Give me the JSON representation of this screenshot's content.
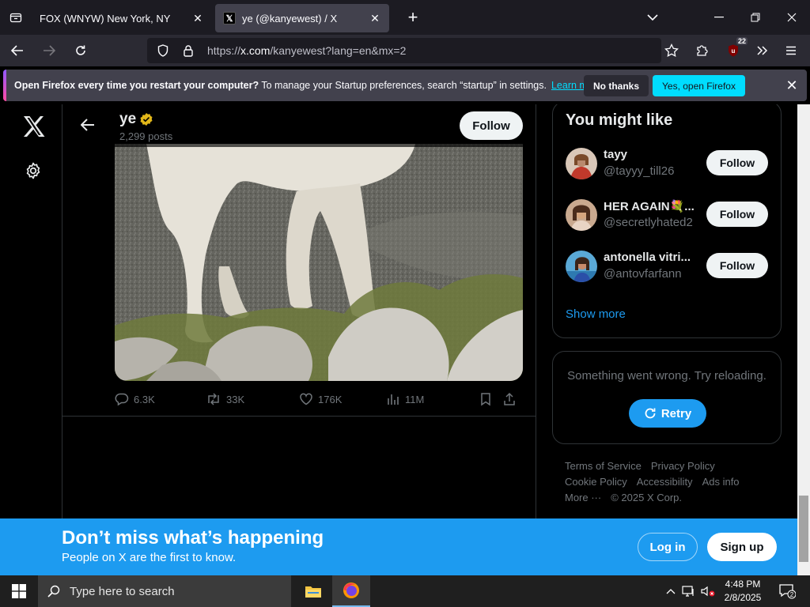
{
  "browser": {
    "tabs": [
      {
        "title": "FOX (WNYW) New York, NY",
        "active": false
      },
      {
        "title": "ye (@kanyewest) / X",
        "active": true
      }
    ],
    "url_prefix": "https://",
    "url_domain": "x.com",
    "url_rest": "/kanyewest?lang=en&mx=2",
    "extension_badge": "22"
  },
  "notification": {
    "bold": "Open Firefox every time you restart your computer?",
    "text": " To manage your Startup preferences, search “startup” in settings.",
    "link": "Learn more",
    "no_label": "No thanks",
    "yes_label": "Yes, open Firefox"
  },
  "profile": {
    "name": "ye",
    "posts": "2,299 posts",
    "follow_label": "Follow"
  },
  "tweet_actions": {
    "replies": "6.3K",
    "reposts": "33K",
    "likes": "176K",
    "views": "11M"
  },
  "sidebar": {
    "title": "You might like",
    "suggestions": [
      {
        "name": "tayy",
        "handle": "@tayyy_till26",
        "button": "Follow"
      },
      {
        "name": "HER AGAIN💐...",
        "handle": "@secretlyhated2",
        "button": "Follow"
      },
      {
        "name": "antonella vitri...",
        "handle": "@antovfarfann",
        "button": "Follow"
      }
    ],
    "show_more": "Show more",
    "error_message": "Something went wrong. Try reloading.",
    "retry_label": "Retry",
    "footer": {
      "terms": "Terms of Service",
      "privacy": "Privacy Policy",
      "cookie": "Cookie Policy",
      "accessibility": "Accessibility",
      "ads": "Ads info",
      "more": "More ···",
      "copyright": "© 2025 X Corp."
    }
  },
  "banner": {
    "headline": "Don’t miss what’s happening",
    "subtext": "People on X are the first to know.",
    "login": "Log in",
    "signup": "Sign up"
  },
  "taskbar": {
    "search_placeholder": "Type here to search",
    "time": "4:48 PM",
    "date": "2/8/2025",
    "notification_count": "2"
  },
  "colors": {
    "x_blue": "#1d9bf0",
    "firefox_accent": "#00ddff",
    "verified_gold": "#e2b719"
  }
}
